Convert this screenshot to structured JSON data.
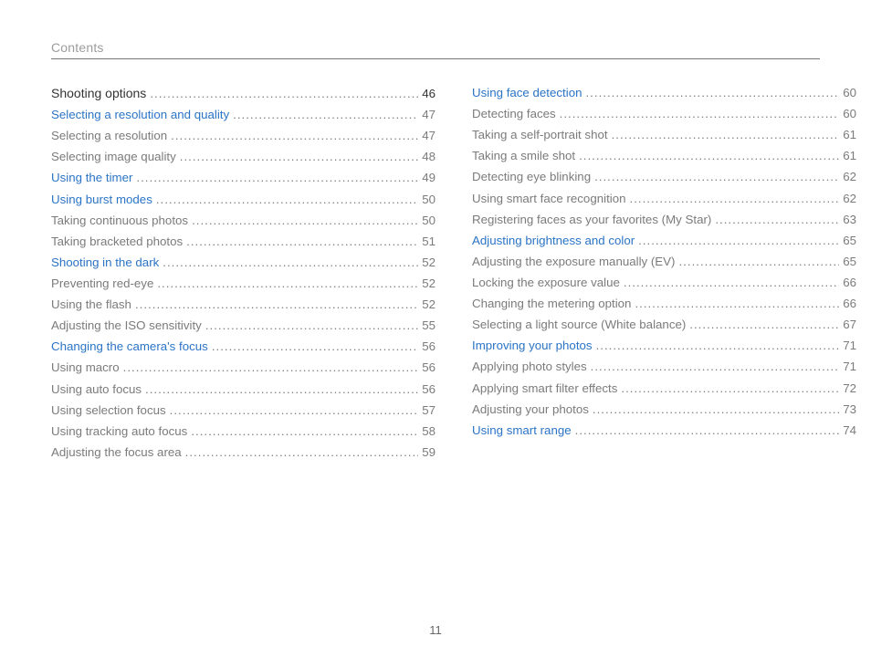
{
  "header": {
    "title": "Contents"
  },
  "footer": {
    "page_number": "11"
  },
  "left_column": [
    {
      "label": "Shooting options",
      "page": "46",
      "style": "heading"
    },
    {
      "label": "Selecting a resolution and quality",
      "page": "47",
      "style": "link"
    },
    {
      "label": "Selecting a resolution",
      "page": "47",
      "style": "normal"
    },
    {
      "label": "Selecting image quality",
      "page": "48",
      "style": "normal"
    },
    {
      "label": "Using the timer",
      "page": "49",
      "style": "link"
    },
    {
      "label": "Using burst modes",
      "page": "50",
      "style": "link"
    },
    {
      "label": "Taking continuous photos",
      "page": "50",
      "style": "normal"
    },
    {
      "label": "Taking bracketed photos",
      "page": "51",
      "style": "normal"
    },
    {
      "label": "Shooting in the dark",
      "page": "52",
      "style": "link"
    },
    {
      "label": "Preventing red-eye",
      "page": "52",
      "style": "normal"
    },
    {
      "label": "Using the flash",
      "page": "52",
      "style": "normal"
    },
    {
      "label": "Adjusting the ISO sensitivity",
      "page": "55",
      "style": "normal"
    },
    {
      "label": "Changing the camera's focus",
      "page": "56",
      "style": "link"
    },
    {
      "label": "Using macro",
      "page": "56",
      "style": "normal"
    },
    {
      "label": "Using auto focus",
      "page": "56",
      "style": "normal"
    },
    {
      "label": "Using selection focus",
      "page": "57",
      "style": "normal"
    },
    {
      "label": "Using tracking auto focus",
      "page": "58",
      "style": "normal"
    },
    {
      "label": "Adjusting the focus area",
      "page": "59",
      "style": "normal"
    }
  ],
  "right_column": [
    {
      "label": "Using face detection",
      "page": "60",
      "style": "link"
    },
    {
      "label": "Detecting faces",
      "page": "60",
      "style": "normal"
    },
    {
      "label": "Taking a self-portrait shot",
      "page": "61",
      "style": "normal"
    },
    {
      "label": "Taking a smile shot",
      "page": "61",
      "style": "normal"
    },
    {
      "label": "Detecting eye blinking",
      "page": "62",
      "style": "normal"
    },
    {
      "label": "Using smart face recognition",
      "page": "62",
      "style": "normal"
    },
    {
      "label": "Registering faces as your favorites (My Star)",
      "page": "63",
      "style": "normal"
    },
    {
      "label": "Adjusting brightness and color",
      "page": "65",
      "style": "link"
    },
    {
      "label": "Adjusting the exposure manually (EV)",
      "page": "65",
      "style": "normal"
    },
    {
      "label": "Locking the exposure value",
      "page": "66",
      "style": "normal"
    },
    {
      "label": "Changing the metering option",
      "page": "66",
      "style": "normal"
    },
    {
      "label": "Selecting a light source (White balance)",
      "page": "67",
      "style": "normal"
    },
    {
      "label": "Improving your photos",
      "page": "71",
      "style": "link"
    },
    {
      "label": "Applying photo styles",
      "page": "71",
      "style": "normal"
    },
    {
      "label": "Applying smart filter effects",
      "page": "72",
      "style": "normal"
    },
    {
      "label": "Adjusting your photos",
      "page": "73",
      "style": "normal"
    },
    {
      "label": "Using smart range",
      "page": "74",
      "style": "link"
    }
  ]
}
